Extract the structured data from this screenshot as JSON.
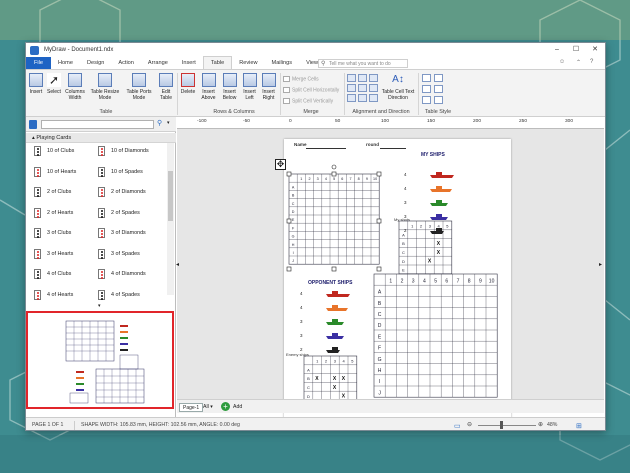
{
  "window": {
    "title": "MyDraw - Document1.ndx"
  },
  "menu": {
    "tabs": [
      "File",
      "Home",
      "Design",
      "Action",
      "Arrange",
      "Insert",
      "Table",
      "Review",
      "Mailings",
      "View"
    ],
    "active": "Table",
    "tell_me": "Tell me what you want to do"
  },
  "ribbon": {
    "buttons": [
      {
        "id": "insert",
        "label": "Insert"
      },
      {
        "id": "select",
        "label": "Select"
      },
      {
        "id": "columns",
        "label": "Columns Width"
      },
      {
        "id": "resize",
        "label": "Table Resize Mode"
      },
      {
        "id": "ports",
        "label": "Table Ports Mode"
      },
      {
        "id": "edit",
        "label": "Edit Table"
      },
      {
        "id": "delete",
        "label": "Delete"
      },
      {
        "id": "above",
        "label": "Insert Above"
      },
      {
        "id": "below",
        "label": "Insert Below"
      },
      {
        "id": "left",
        "label": "Insert Left"
      },
      {
        "id": "right",
        "label": "Insert Right"
      }
    ],
    "merge_items": [
      "Merge Cells",
      "Split Cell Horizontally",
      "Split Cell Vertically"
    ],
    "text_dir_label": "Table Cell Text Direction",
    "groups": [
      "Table",
      "Rows & Columns",
      "Merge",
      "Alignment and Direction",
      "Table Style"
    ]
  },
  "library": {
    "category": "Playing Cards",
    "items": [
      [
        "10 of Clubs",
        "10 of Diamonds"
      ],
      [
        "10 of Hearts",
        "10 of Spades"
      ],
      [
        "2 of Clubs",
        "2 of Diamonds"
      ],
      [
        "2 of Hearts",
        "2 of Spades"
      ],
      [
        "3 of Clubs",
        "3 of Diamonds"
      ],
      [
        "3 of Hearts",
        "3 of Spades"
      ],
      [
        "4 of Clubs",
        "4 of Diamonds"
      ],
      [
        "4 of Hearts",
        "4 of Spades"
      ]
    ]
  },
  "ruler": {
    "h_ticks": [
      "-100",
      "-50",
      "0",
      "50",
      "100",
      "150",
      "200",
      "250",
      "300",
      "350"
    ],
    "v_ticks": [
      "50",
      "100",
      "150",
      "200",
      "250"
    ]
  },
  "doc": {
    "name_label": "Name",
    "round_label": "round",
    "my_ships": "MY SHIPS",
    "opponent_ships": "OPPONENT SHIPS",
    "my_shots": "My shots",
    "enemy_shots": "Enemy ships",
    "ship_counts": [
      "4",
      "4",
      "3",
      "3",
      "2"
    ],
    "ship_counts_opp": [
      "4",
      "4",
      "3",
      "3",
      "2"
    ],
    "small_cols": [
      "1",
      "2",
      "3",
      "4",
      "5"
    ],
    "small_rows": [
      "A",
      "B",
      "C",
      "D",
      "E"
    ],
    "grid_cols": [
      "1",
      "2",
      "3",
      "4",
      "5",
      "6",
      "7",
      "8",
      "9",
      "10"
    ],
    "grid_rows": [
      "A",
      "B",
      "C",
      "D",
      "E",
      "F",
      "G",
      "H",
      "I",
      "J"
    ],
    "my_marks": [
      "X",
      "X",
      "X"
    ],
    "enemy_marks": [
      "X",
      "X",
      "X",
      "X",
      "X"
    ],
    "ship_colors": [
      "#c0281f",
      "#e8742a",
      "#2a8a2a",
      "#3b2fa3",
      "#222222"
    ]
  },
  "pagebar": {
    "page": "Page-1",
    "all": "All",
    "add": "Add"
  },
  "status": {
    "page": "PAGE 1 OF 1",
    "shape": "SHAPE WIDTH: 105.83 mm, HEIGHT: 102.56 mm, ANGLE: 0.00 deg",
    "zoom": "48%"
  }
}
